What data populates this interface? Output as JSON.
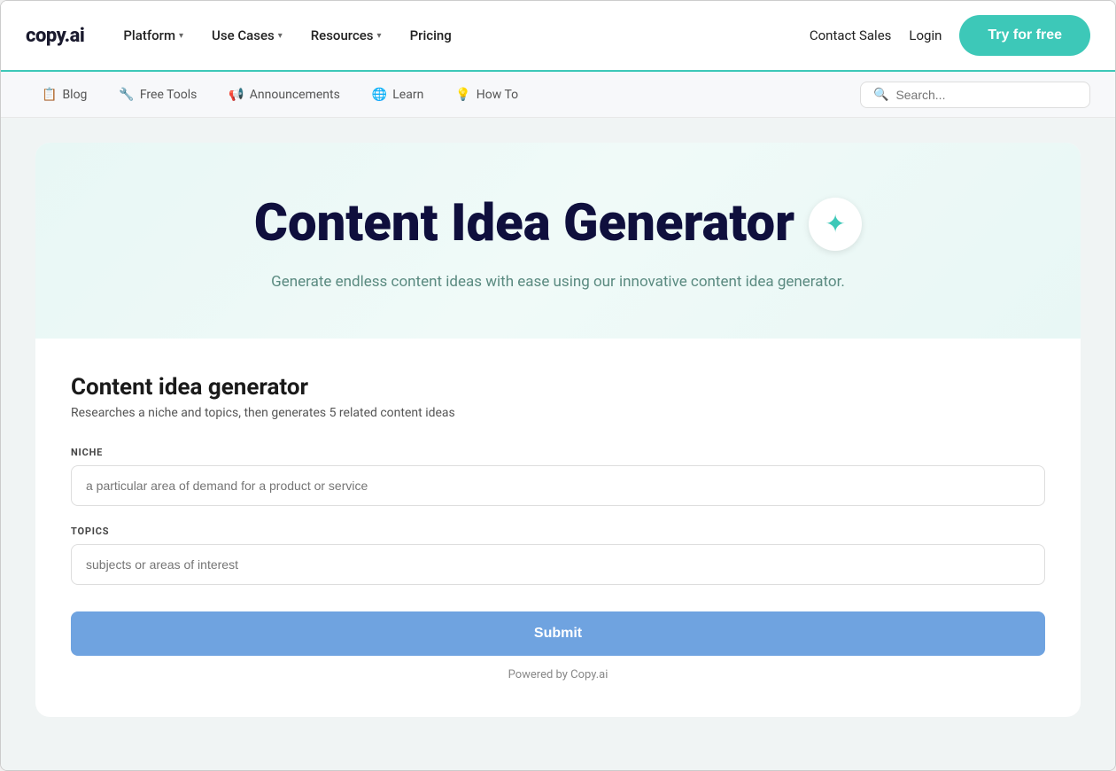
{
  "logo": "copy.ai",
  "nav": {
    "items": [
      {
        "label": "Platform",
        "hasDropdown": true
      },
      {
        "label": "Use Cases",
        "hasDropdown": true
      },
      {
        "label": "Resources",
        "hasDropdown": true
      },
      {
        "label": "Pricing",
        "hasDropdown": false
      }
    ],
    "contact_sales": "Contact Sales",
    "login": "Login",
    "try_btn": "Try for free"
  },
  "subnav": {
    "items": [
      {
        "icon": "📋",
        "label": "Blog"
      },
      {
        "icon": "🔧",
        "label": "Free Tools"
      },
      {
        "icon": "📢",
        "label": "Announcements"
      },
      {
        "icon": "🌐",
        "label": "Learn"
      },
      {
        "icon": "💡",
        "label": "How To"
      }
    ],
    "search_placeholder": "Search..."
  },
  "hero": {
    "title": "Content Idea Generator",
    "sparkle": "✦",
    "subtitle": "Generate endless content ideas with ease using our innovative content idea generator."
  },
  "form": {
    "title": "Content idea generator",
    "description": "Researches a niche and topics, then generates 5 related content ideas",
    "fields": [
      {
        "id": "niche",
        "label": "NICHE",
        "placeholder": "a particular area of demand for a product or service"
      },
      {
        "id": "topics",
        "label": "TOPICS",
        "placeholder": "subjects or areas of interest"
      }
    ],
    "submit_label": "Submit",
    "powered_by": "Powered by Copy.ai"
  }
}
